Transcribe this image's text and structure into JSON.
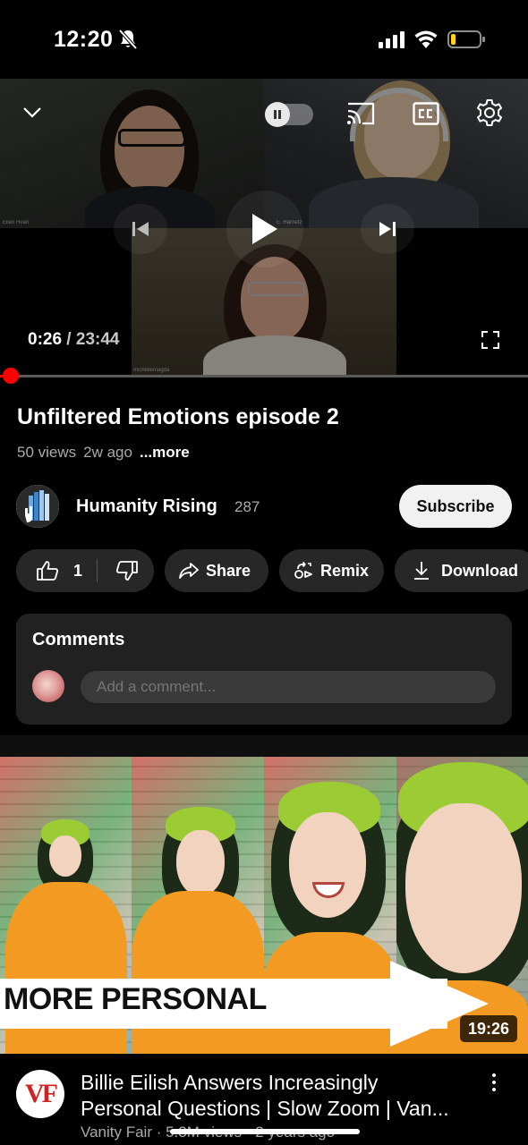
{
  "status_bar": {
    "time": "12:20",
    "icons": [
      "bell-slash-icon",
      "cellular-signal-icon",
      "wifi-icon",
      "battery-low-icon"
    ],
    "battery_color": "#ffd60a"
  },
  "player": {
    "participants": [
      "Ellen Hoan",
      "E. Harnetz",
      "michellemagda"
    ],
    "current_time": "0:26",
    "separator": " / ",
    "duration": "23:44",
    "progress_fraction": 0.018,
    "controls": [
      "chevron-down-icon",
      "autoplay-toggle",
      "cast-icon",
      "closed-captions-icon",
      "settings-gear-icon",
      "previous-icon",
      "play-icon",
      "next-icon",
      "fullscreen-icon"
    ]
  },
  "video": {
    "title": "Unfiltered Emotions episode 2",
    "views": "50 views",
    "age": "2w ago",
    "more_label": "...more"
  },
  "channel": {
    "name": "Humanity Rising",
    "subscribers": "287",
    "subscribe_label": "Subscribe"
  },
  "actions": {
    "like_count": "1",
    "share_label": "Share",
    "remix_label": "Remix",
    "download_label": "Download"
  },
  "comments": {
    "title": "Comments",
    "placeholder": "Add a comment..."
  },
  "recommendation": {
    "thumbnail_text": "MORE PERSONAL",
    "duration": "19:26",
    "channel_logo_text": "VF",
    "title_line1": "Billie Eilish Answers Increasingly",
    "title_line2": "Personal Questions | Slow Zoom | Van...",
    "meta": "Vanity Fair · 5.3M views · 2 years ago",
    "accent_color": "#f29a22"
  },
  "colors": {
    "background": "#000000",
    "progress": "#ff0000",
    "pill": "#272727",
    "card": "#212121"
  }
}
